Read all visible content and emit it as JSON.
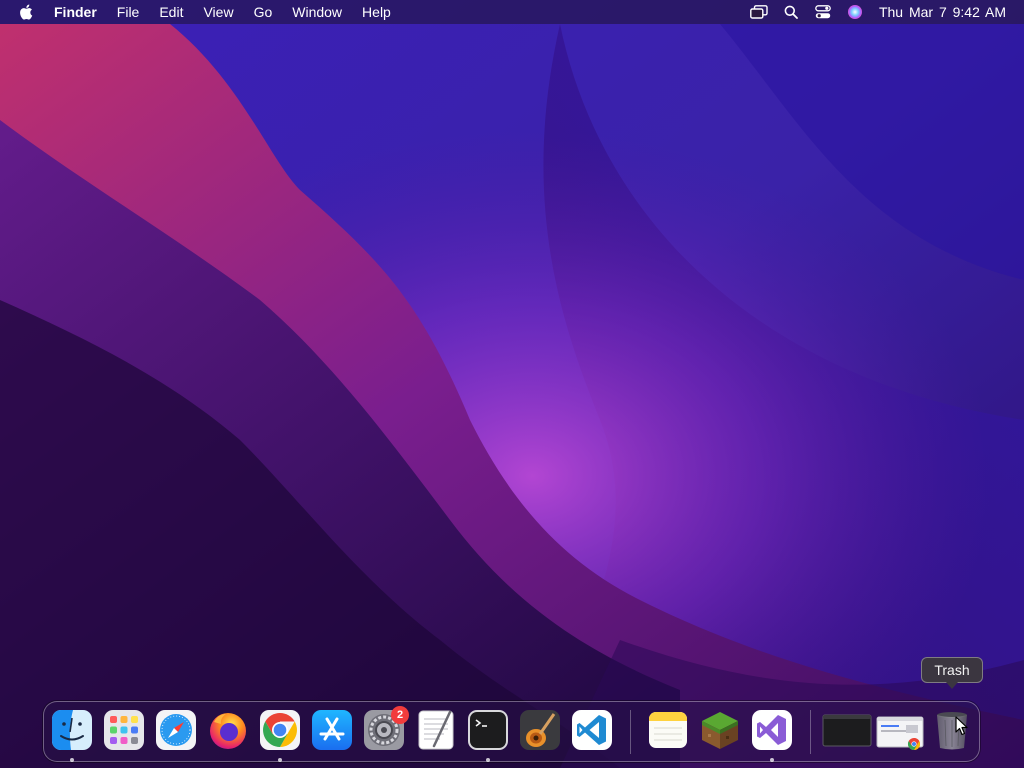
{
  "menubar": {
    "app_name": "Finder",
    "menus": [
      "File",
      "Edit",
      "View",
      "Go",
      "Window",
      "Help"
    ],
    "clock": "Thu Mar 7  9:42 AM",
    "status_icons": [
      "screen-mirroring-icon",
      "search-icon",
      "control-center-icon",
      "siri-icon"
    ]
  },
  "dock": {
    "apps": [
      {
        "name": "finder",
        "running": true
      },
      {
        "name": "launchpad",
        "running": false
      },
      {
        "name": "safari",
        "running": false
      },
      {
        "name": "firefox",
        "running": false
      },
      {
        "name": "chrome",
        "running": true
      },
      {
        "name": "app-store",
        "running": false
      },
      {
        "name": "system-preferences",
        "running": false,
        "badge": "2"
      },
      {
        "name": "textedit",
        "running": false
      },
      {
        "name": "terminal",
        "running": true
      },
      {
        "name": "garageband",
        "running": false
      },
      {
        "name": "vscode",
        "running": false
      },
      {
        "name": "notes",
        "running": false
      },
      {
        "name": "minecraft",
        "running": false
      },
      {
        "name": "visual-studio",
        "running": true
      },
      {
        "name": "terminal-window-minimized",
        "running": false
      },
      {
        "name": "chrome-window-minimized",
        "running": false
      },
      {
        "name": "trash",
        "running": false
      }
    ],
    "badge_text": "2"
  },
  "tooltip": {
    "text": "Trash"
  },
  "colors": {
    "accent_badge": "#f23c3c",
    "vscode_blue": "#1f8ad2",
    "visual_studio_purple": "#8a5cd6"
  }
}
